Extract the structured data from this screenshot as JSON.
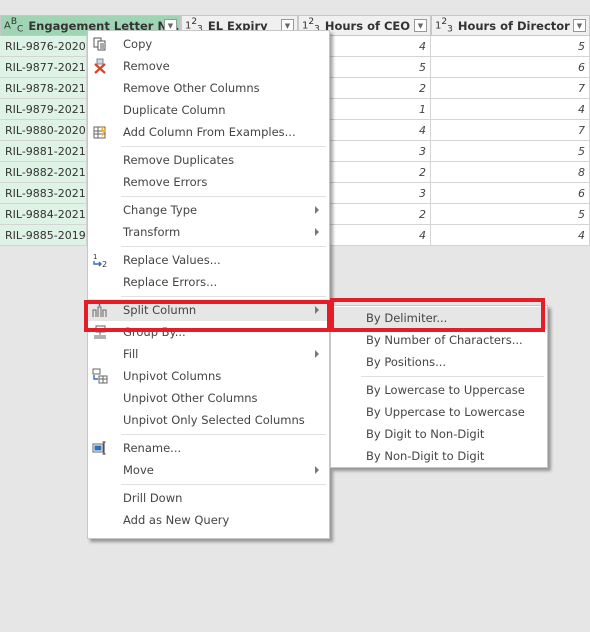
{
  "table": {
    "columns": [
      {
        "type_icon": "ABC",
        "name": "Engagement Letter No.",
        "selected": true
      },
      {
        "type_icon": "123",
        "name": "EL Expiry",
        "selected": false
      },
      {
        "type_icon": "123",
        "name": "Hours of CEO",
        "selected": false
      },
      {
        "type_icon": "123",
        "name": "Hours of Director",
        "selected": false
      }
    ],
    "rows": [
      {
        "id": "RIL-9876-2020",
        "ceo": "4",
        "director": "5"
      },
      {
        "id": "RIL-9877-2021",
        "ceo": "5",
        "director": "6"
      },
      {
        "id": "RIL-9878-2021",
        "ceo": "2",
        "director": "7"
      },
      {
        "id": "RIL-9879-2021",
        "ceo": "1",
        "director": "4"
      },
      {
        "id": "RIL-9880-2020",
        "ceo": "4",
        "director": "7"
      },
      {
        "id": "RIL-9881-2021",
        "ceo": "3",
        "director": "5"
      },
      {
        "id": "RIL-9882-2021",
        "ceo": "2",
        "director": "8"
      },
      {
        "id": "RIL-9883-2021",
        "ceo": "3",
        "director": "6"
      },
      {
        "id": "RIL-9884-2021",
        "ceo": "2",
        "director": "5"
      },
      {
        "id": "RIL-9885-2019",
        "ceo": "4",
        "director": "4"
      }
    ]
  },
  "context_menu": {
    "items": [
      {
        "label": "Copy",
        "icon": "copy-icon"
      },
      {
        "label": "Remove",
        "icon": "remove-column-icon"
      },
      {
        "label": "Remove Other Columns"
      },
      {
        "label": "Duplicate Column"
      },
      {
        "label": "Add Column From Examples...",
        "icon": "add-column-examples-icon"
      },
      {
        "label": "Remove Duplicates"
      },
      {
        "label": "Remove Errors"
      },
      {
        "label": "Change Type",
        "submenu": true
      },
      {
        "label": "Transform",
        "submenu": true
      },
      {
        "label": "Replace Values...",
        "icon": "replace-values-icon"
      },
      {
        "label": "Replace Errors..."
      },
      {
        "label": "Split Column",
        "icon": "split-column-icon",
        "submenu": true,
        "highlighted": true
      },
      {
        "label": "Group By...",
        "icon": "group-by-icon"
      },
      {
        "label": "Fill",
        "submenu": true
      },
      {
        "label": "Unpivot Columns",
        "icon": "unpivot-icon"
      },
      {
        "label": "Unpivot Other Columns"
      },
      {
        "label": "Unpivot Only Selected Columns"
      },
      {
        "label": "Rename...",
        "icon": "rename-icon"
      },
      {
        "label": "Move",
        "submenu": true
      },
      {
        "label": "Drill Down"
      },
      {
        "label": "Add as New Query"
      }
    ]
  },
  "split_submenu": {
    "items": [
      {
        "label": "By Delimiter...",
        "highlighted": true
      },
      {
        "label": "By Number of Characters..."
      },
      {
        "label": "By Positions..."
      },
      {
        "label": "By Lowercase to Uppercase"
      },
      {
        "label": "By Uppercase to Lowercase"
      },
      {
        "label": "By Digit to Non-Digit"
      },
      {
        "label": "By Non-Digit to Digit"
      }
    ]
  },
  "colors": {
    "selected_header": "#9fd5b5",
    "selected_cell": "#dff2e6",
    "annotation_red": "#e51d27"
  }
}
